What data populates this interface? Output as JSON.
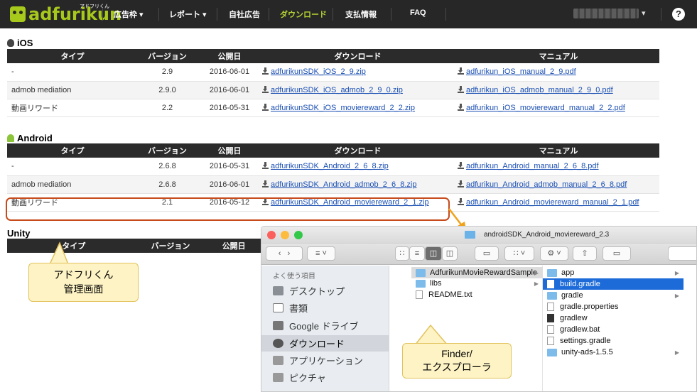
{
  "nav": {
    "logo": "adfurikun",
    "logo_sub": "アドフリくん",
    "items": [
      "広告枠 ▾",
      "レポート ▾",
      "自社広告",
      "ダウンロード",
      "支払情報",
      "FAQ"
    ],
    "user_caret": "▾",
    "help": "?"
  },
  "table_headers": [
    "タイプ",
    "バージョン",
    "公開日",
    "ダウンロード",
    "マニュアル"
  ],
  "ios": {
    "title": "iOS",
    "rows": [
      {
        "type": "-",
        "version": "2.9",
        "date": "2016-06-01",
        "sdk": "adfurikunSDK_iOS_2_9.zip",
        "manual": "adfurikun_iOS_manual_2_9.pdf"
      },
      {
        "type": "admob mediation",
        "version": "2.9.0",
        "date": "2016-06-01",
        "sdk": "adfurikunSDK_iOS_admob_2_9_0.zip",
        "manual": "adfurikun_iOS_admob_manual_2_9_0.pdf"
      },
      {
        "type": "動画リワード",
        "version": "2.2",
        "date": "2016-05-31",
        "sdk": "adfurikunSDK_iOS_moviereward_2_2.zip",
        "manual": "adfurikun_iOS_moviereward_manual_2_2.pdf"
      }
    ]
  },
  "android": {
    "title": "Android",
    "rows": [
      {
        "type": "-",
        "version": "2.6.8",
        "date": "2016-05-31",
        "sdk": "adfurikunSDK_Android_2_6_8.zip",
        "manual": "adfurikun_Android_manual_2_6_8.pdf"
      },
      {
        "type": "admob mediation",
        "version": "2.6.8",
        "date": "2016-06-01",
        "sdk": "adfurikunSDK_Android_admob_2_6_8.zip",
        "manual": "adfurikun_Android_admob_manual_2_6_8.pdf"
      },
      {
        "type": "動画リワード",
        "version": "2.1",
        "date": "2016-05-12",
        "sdk": "adfurikunSDK_Android_moviereward_2_1.zip",
        "manual": "adfurikun_Android_moviereward_manual_2_1.pdf"
      }
    ]
  },
  "unity": {
    "title": "Unity",
    "headers": [
      "タイプ",
      "バージョン",
      "公開日"
    ]
  },
  "callouts": {
    "admin_line1": "アドフリくん",
    "admin_line2": "管理画面",
    "finder_line1": "Finder/",
    "finder_line2": "エクスプローラ"
  },
  "finder": {
    "title": "androidSDK_Android_moviereward_2.3",
    "sidebar_heading": "よく使う項目",
    "sidebar_items": [
      "デスクトップ",
      "書類",
      "Google ドライブ",
      "ダウンロード",
      "アプリケーション",
      "ピクチャ"
    ],
    "col1": [
      "AdfurikunMovieRewardSample",
      "libs",
      "README.txt"
    ],
    "col2": [
      "app",
      "build.gradle",
      "gradle",
      "gradle.properties",
      "gradlew",
      "gradlew.bat",
      "settings.gradle",
      "unity-ads-1.5.5"
    ]
  }
}
